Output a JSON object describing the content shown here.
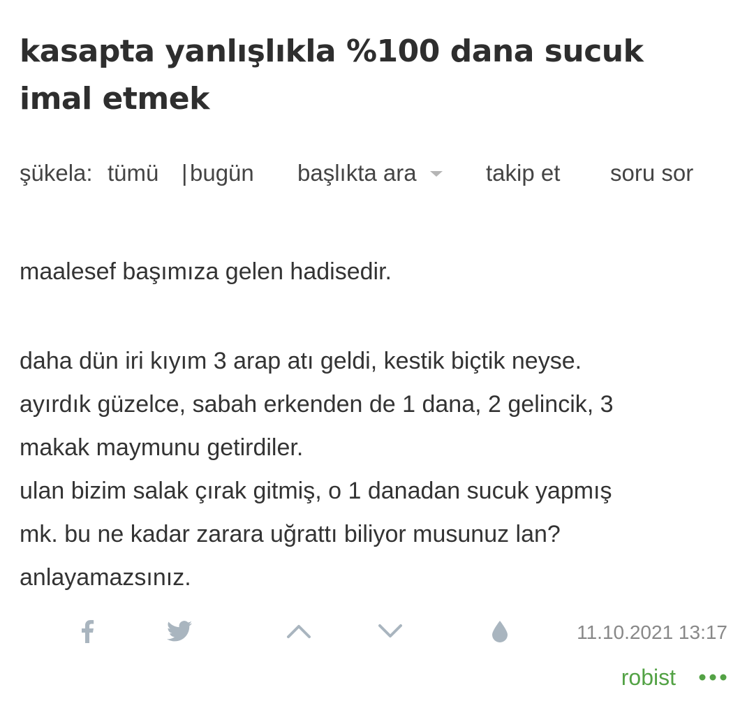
{
  "topic": {
    "title": "kasapta yanlışlıkla %100 dana sucuk imal etmek"
  },
  "subnav": {
    "sukela_label": "şükela:",
    "sukela_all": "tümü",
    "separator": "|",
    "sukela_today": "bugün",
    "search_in_title": "başlıkta ara",
    "follow": "takip et",
    "ask": "soru sor"
  },
  "entry": {
    "paragraph_1": "maalesef başımıza gelen hadisedir.",
    "lines": [
      "daha dün iri kıyım 3 arap atı geldi, kestik biçtik neyse.",
      "ayırdık güzelce, sabah erkenden de 1 dana, 2 gelincik, 3",
      "makak maymunu getirdiler.",
      "ulan bizim salak çırak gitmiş, o 1 danadan sucuk yapmış",
      "mk. bu ne kadar zarara uğrattı biliyor musunuz lan?",
      "anlayamazsınız."
    ],
    "date": "11.10.2021 13:17",
    "author": "robist"
  },
  "icons": {
    "facebook": "facebook-icon",
    "twitter": "twitter-icon",
    "upvote": "chevron-up-icon",
    "downvote": "chevron-down-icon",
    "drop": "drop-icon",
    "more": "more-dots-icon"
  },
  "colors": {
    "text": "#333333",
    "icon": "#a9b5bf",
    "date": "#888888",
    "author": "#53a245"
  }
}
